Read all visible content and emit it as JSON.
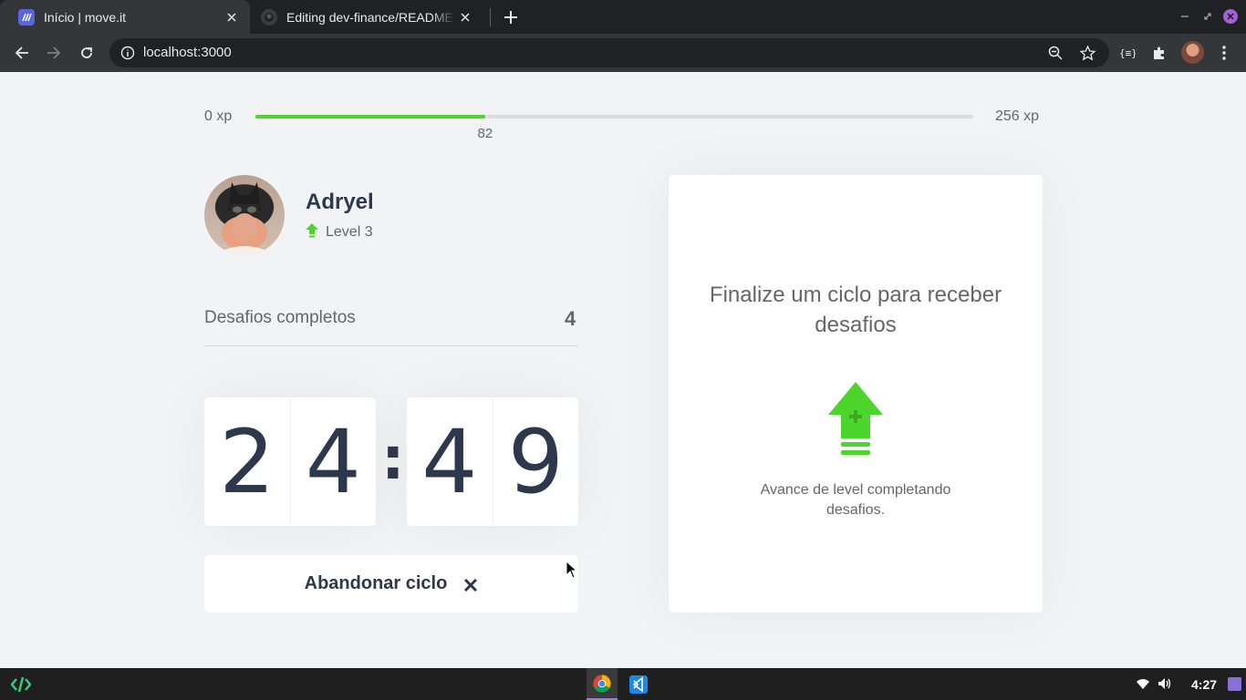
{
  "browser": {
    "tabs": [
      {
        "title": "Início | move.it",
        "active": true,
        "icon": "move-it-favicon"
      },
      {
        "title": "Editing dev-finance/README.md",
        "active": false,
        "icon": "github-favicon"
      }
    ],
    "url": "localhost:3000"
  },
  "xp": {
    "min_label": "0 xp",
    "max_label": "256 xp",
    "current_label": "82",
    "progress": 0.32,
    "bar_color": "#4cd62b"
  },
  "profile": {
    "name": "Adryel",
    "level_label": "Level 3"
  },
  "challenges": {
    "label": "Desafios completos",
    "count": "4"
  },
  "countdown": {
    "minute_left": "2",
    "minute_right": "4",
    "separator": ":",
    "second_left": "4",
    "second_right": "9"
  },
  "abandon_button": {
    "label": "Abandonar ciclo"
  },
  "challenge_card": {
    "title": "Finalize um ciclo para receber desafios",
    "text": "Avance de level completando desafios.",
    "icon": "level-up-icon"
  },
  "taskbar": {
    "clock": "4:27"
  },
  "colors": {
    "accent_green": "#4cd62b",
    "title_color": "#2e384d",
    "text_color": "#666666",
    "background": "#f2f3f5"
  }
}
